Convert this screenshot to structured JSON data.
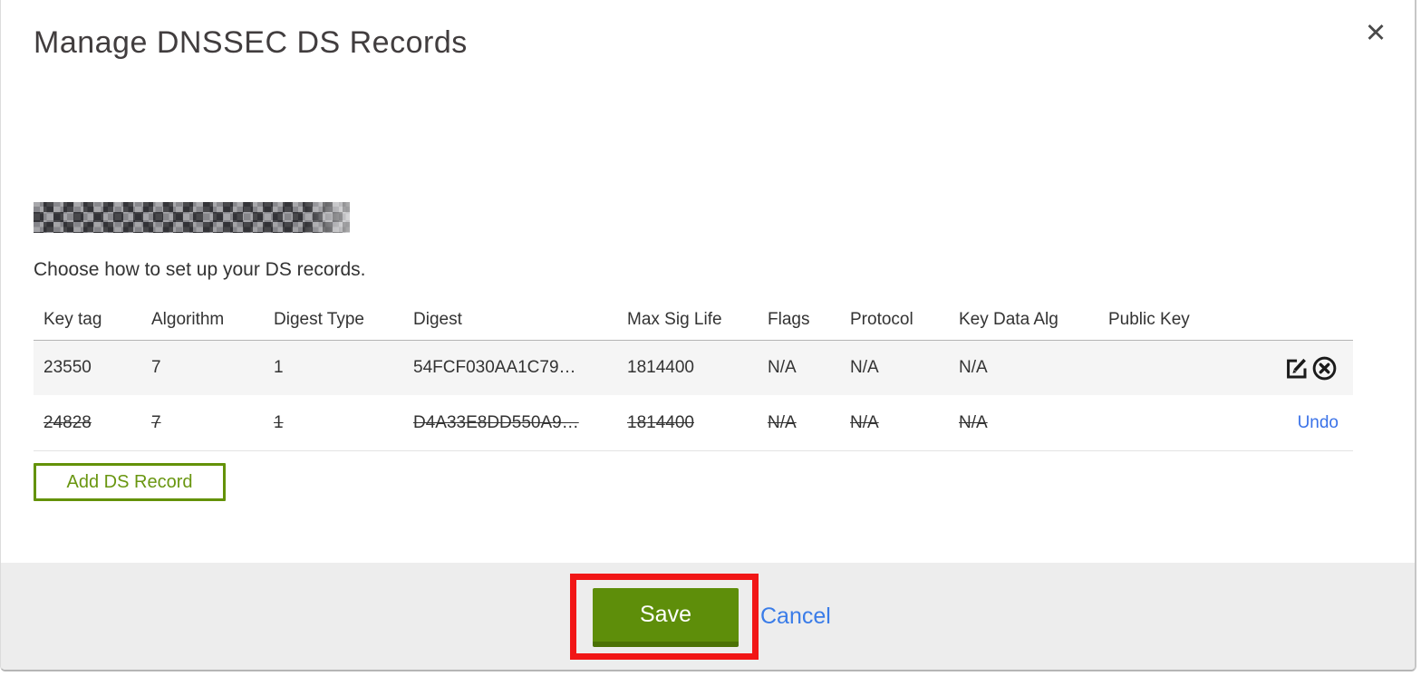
{
  "window": {
    "title": "Manage DNSSEC DS Records"
  },
  "icons": {
    "close": "✕"
  },
  "intro": {
    "domain_redacted": true,
    "instruction": "Choose how to set up your DS records."
  },
  "table": {
    "columns": [
      "Key tag",
      "Algorithm",
      "Digest Type",
      "Digest",
      "Max Sig Life",
      "Flags",
      "Protocol",
      "Key Data Alg",
      "Public Key",
      ""
    ],
    "rows": [
      {
        "key_tag": "23550",
        "algorithm": "7",
        "digest_type": "1",
        "digest": "54FCF030AA1C79…",
        "max_sig_life": "1814400",
        "flags": "N/A",
        "protocol": "N/A",
        "key_data_alg": "N/A",
        "public_key": "",
        "state": "active",
        "actions": [
          "edit",
          "delete"
        ]
      },
      {
        "key_tag": "24828",
        "algorithm": "7",
        "digest_type": "1",
        "digest": "D4A33E8DD550A9…",
        "max_sig_life": "1814400",
        "flags": "N/A",
        "protocol": "N/A",
        "key_data_alg": "N/A",
        "public_key": "",
        "state": "marked-for-deletion",
        "undo_label": "Undo"
      }
    ]
  },
  "buttons": {
    "add_ds_record": "Add DS Record",
    "save": "Save",
    "cancel": "Cancel"
  },
  "colors": {
    "accent_green": "#5e8e0a",
    "add_button_green": "#699610",
    "link_blue": "#3a7ce8",
    "annotation_red": "#f11616",
    "row_highlight": "#f5f5f5",
    "footer_gray": "#ededed"
  }
}
